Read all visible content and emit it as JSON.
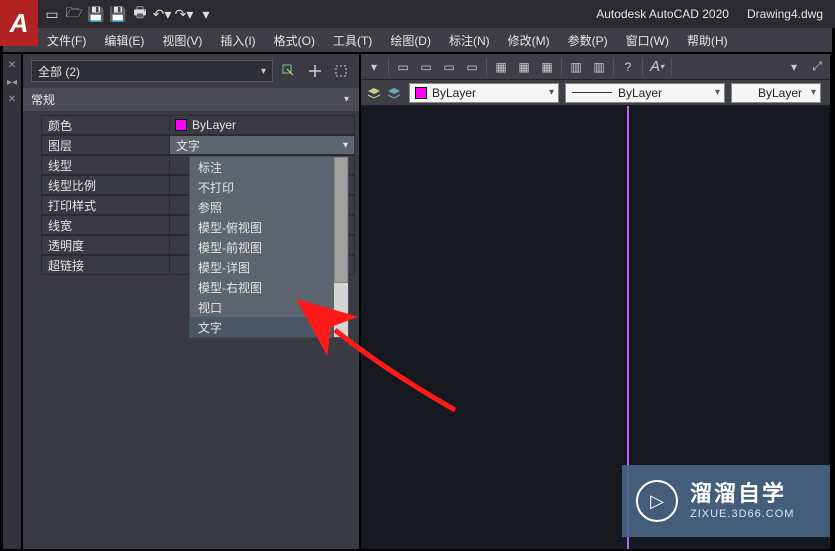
{
  "title": {
    "app": "Autodesk AutoCAD 2020",
    "doc": "Drawing4.dwg"
  },
  "menu": {
    "file": "文件(F)",
    "edit": "编辑(E)",
    "view": "视图(V)",
    "insert": "插入(I)",
    "format": "格式(O)",
    "tools": "工具(T)",
    "draw": "绘图(D)",
    "dimension": "标注(N)",
    "modify": "修改(M)",
    "params": "参数(P)",
    "window": "窗口(W)",
    "help": "帮助(H)"
  },
  "panel": {
    "selection": "全部 (2)",
    "section": "常规",
    "rows": {
      "color_label": "颜色",
      "color_value": "ByLayer",
      "layer_label": "图层",
      "layer_value": "文字",
      "linetype_label": "线型",
      "ltscale_label": "线型比例",
      "plotstyle_label": "打印样式",
      "lineweight_label": "线宽",
      "transp_label": "透明度",
      "hyperlink_label": "超链接"
    },
    "dropdown": {
      "items": [
        "标注",
        "不打印",
        "参照",
        "模型-俯视图",
        "模型-前视图",
        "模型-详图",
        "模型-右视图",
        "视口",
        "文字"
      ],
      "selected": "文字"
    }
  },
  "layerbar": {
    "c1": "ByLayer",
    "c2": "ByLayer",
    "c3": "ByLayer"
  },
  "watermark": {
    "big": "溜溜自学",
    "small": "ZIXUE.3D66.COM"
  }
}
